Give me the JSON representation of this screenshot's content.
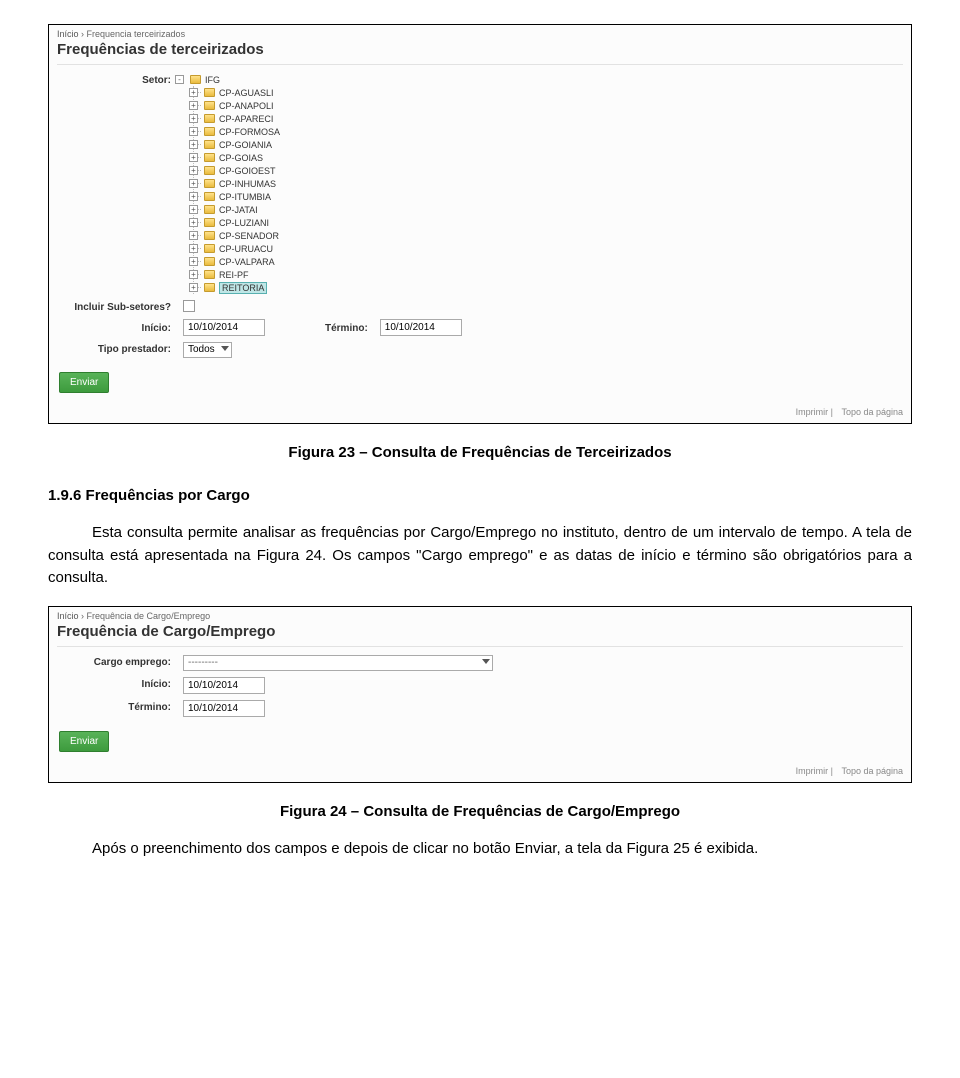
{
  "fig23": {
    "breadcrumb_home": "Início",
    "breadcrumb_current": "Frequencia terceirizados",
    "title": "Frequências de terceirizados",
    "label_setor": "Setor:",
    "tree_root": "IFG",
    "tree_items": [
      "CP-AGUASLI",
      "CP-ANAPOLI",
      "CP-APARECI",
      "CP-FORMOSA",
      "CP-GOIANIA",
      "CP-GOIAS",
      "CP-GOIOEST",
      "CP-INHUMAS",
      "CP-ITUMBIA",
      "CP-JATAI",
      "CP-LUZIANI",
      "CP-SENADOR",
      "CP-URUACU",
      "CP-VALPARA",
      "REI-PF",
      "REITORIA"
    ],
    "label_subsetores": "Incluir Sub-setores?",
    "label_inicio": "Início:",
    "value_inicio": "10/10/2014",
    "label_termino": "Término:",
    "value_termino": "10/10/2014",
    "label_tipoprestador": "Tipo prestador:",
    "value_tipoprestador": "Todos",
    "btn_enviar": "Enviar",
    "footer_imprimir": "Imprimir",
    "footer_topo": "Topo da página"
  },
  "caption23": "Figura 23 – Consulta de Frequências de Terceirizados",
  "heading": "1.9.6 Frequências por Cargo",
  "para1": "Esta consulta permite analisar as frequências por Cargo/Emprego no instituto, dentro de um intervalo de tempo. A tela de consulta está apresentada na Figura 24. Os campos \"Cargo emprego\" e as datas de início e término são obrigatórios para a consulta.",
  "fig24": {
    "breadcrumb_home": "Início",
    "breadcrumb_current": "Frequência de Cargo/Emprego",
    "title": "Frequência de Cargo/Emprego",
    "label_cargo": "Cargo emprego:",
    "value_cargo": "---------",
    "label_inicio": "Início:",
    "value_inicio": "10/10/2014",
    "label_termino": "Término:",
    "value_termino": "10/10/2014",
    "btn_enviar": "Enviar",
    "footer_imprimir": "Imprimir",
    "footer_topo": "Topo da página"
  },
  "caption24": "Figura 24 – Consulta de Frequências de Cargo/Emprego",
  "para2": "Após o preenchimento dos campos e depois de clicar no botão Enviar, a tela da Figura 25 é exibida."
}
